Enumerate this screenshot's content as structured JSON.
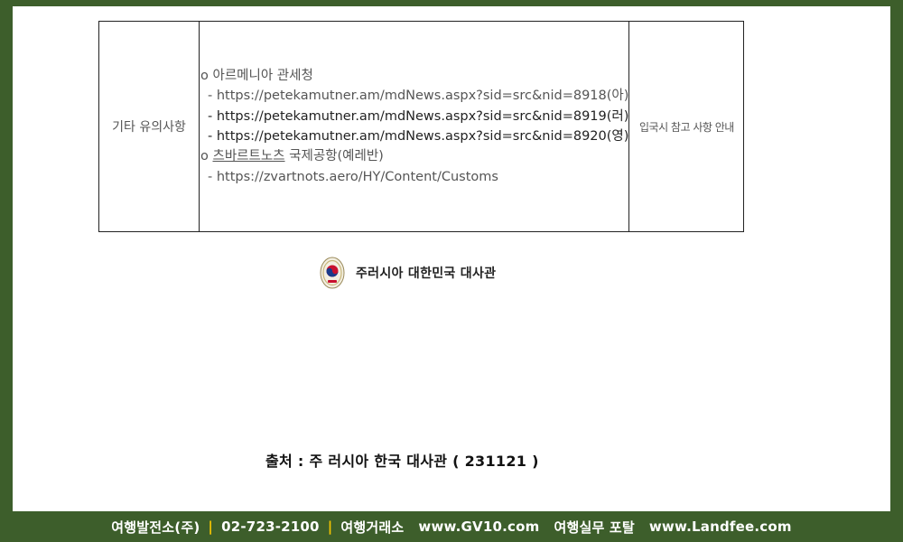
{
  "table": {
    "row_label": "기타 유의사항",
    "content": {
      "bullet1": "o 아르메니아 관세청",
      "links1": [
        "- https://petekamutner.am/mdNews.aspx?sid=src&nid=8918(아)",
        "- https://petekamutner.am/mdNews.aspx?sid=src&nid=8919(러)",
        "- https://petekamutner.am/mdNews.aspx?sid=src&nid=8920(영)"
      ],
      "bullet2_prefix": "o ",
      "bullet2_underlined": "츠바르트노츠",
      "bullet2_suffix": " 국제공항(예레반)",
      "links2": [
        "- https://zvartnots.aero/HY/Content/Customs"
      ]
    },
    "note": "입국시 참고 사항 안내"
  },
  "embassy": {
    "name": "주러시아 대한민국 대사관",
    "seal_icon": "embassy-seal-icon"
  },
  "source": "출처 : 주 러시아 한국 대사관 ( 231121 )",
  "footer": {
    "company": "여행발전소(주)",
    "phone": "02-723-2100",
    "site1_label": "여행거래소",
    "site1_url": "www.GV10.com",
    "site2_label": "여행실무 포탈",
    "site2_url": "www.Landfee.com",
    "separator": "|",
    "separator_color": "#f4c400"
  },
  "colors": {
    "frame": "#3d5e2b",
    "page": "#ffffff"
  }
}
